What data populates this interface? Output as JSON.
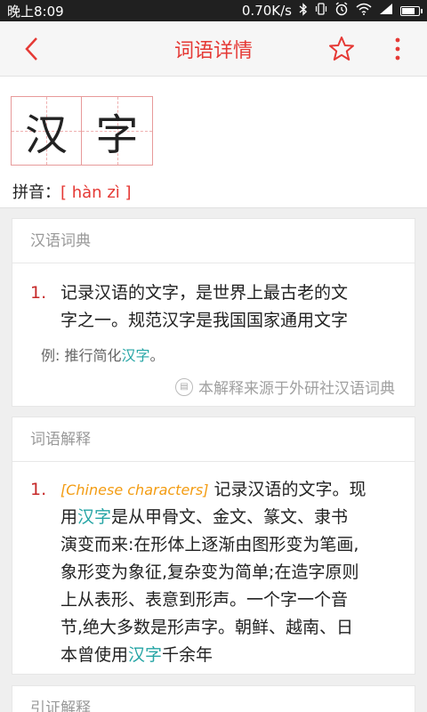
{
  "status": {
    "time": "晚上8:09",
    "speed": "0.70K/s",
    "bluetooth": "bluetooth-icon",
    "alarm": "alarm-icon",
    "wifi": "wifi-icon",
    "signal": "signal-icon",
    "battery_level": 0.8
  },
  "appbar": {
    "title": "词语详情",
    "back_icon": "back-arrow-icon",
    "favorite_icon": "star-icon",
    "more_icon": "more-vert-icon"
  },
  "word": {
    "char1": "汉",
    "char2": "字",
    "pinyin_label": "拼音：",
    "pinyin_value": "[ hàn zì ]"
  },
  "dictionary": {
    "title": "汉语词典",
    "num": "1.",
    "def_line1": "记录汉语的文字，是世界上最古老的文",
    "def_line2": "字之一。规范汉字是我国国家通用文字",
    "example_prefix": "例: 推行简化",
    "example_link": "汉字",
    "example_suffix": "。",
    "source": "本解释来源于外研社汉语词典"
  },
  "explanation": {
    "title": "词语解释",
    "num": "1.",
    "english": "[Chinese characters]",
    "l1_rest": " 记录汉语的文字。现",
    "l2_a": "用",
    "l2_link": "汉字",
    "l2_b": "是从甲骨文、金文、篆文、隶书",
    "l3": "演变而来:在形体上逐渐由图形变为笔画,",
    "l4": "象形变为象征,复杂变为简单;在造字原则",
    "l5": "上从表形、表意到形声。一个字一个音",
    "l6": "节,绝大多数是形声字。朝鲜、越南、日",
    "l7_a": "本曾使用",
    "l7_link": "汉字",
    "l7_b": "千余年"
  },
  "citation": {
    "title": "引证解释"
  },
  "colors": {
    "accent": "#e53935",
    "link": "#26a5a5",
    "english": "#f39c12"
  }
}
